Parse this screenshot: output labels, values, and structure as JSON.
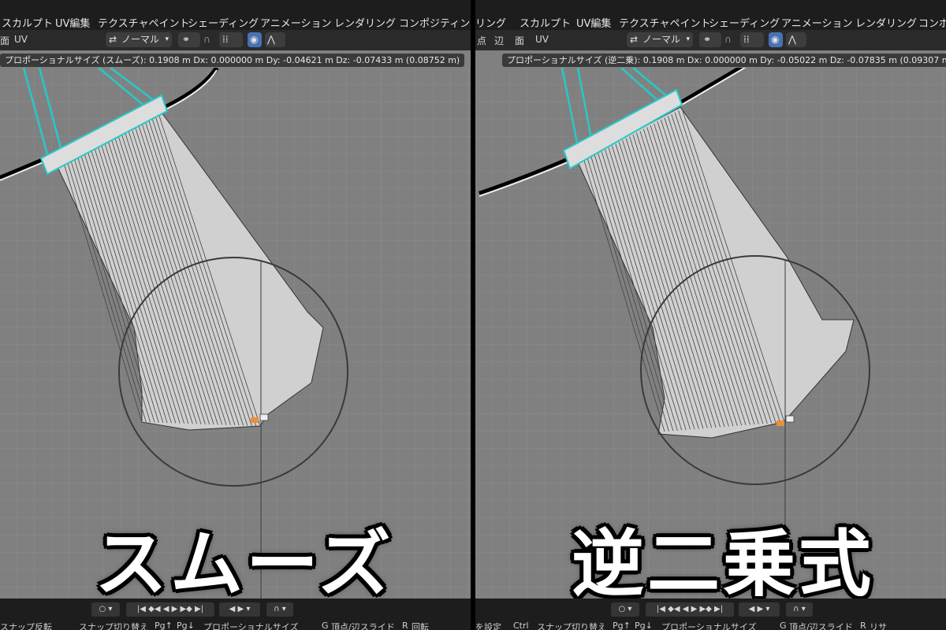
{
  "panels": [
    {
      "menu": [
        "スカルプト",
        "UV編集",
        "テクスチャペイント",
        "シェーディング",
        "アニメーション",
        "レンダリング",
        "コンポジティング"
      ],
      "toolbar": {
        "left": [
          "面",
          "UV"
        ],
        "orientation": "ノーマル"
      },
      "status": "プロポーショナルサイズ (スムーズ): 0.1908 m   Dx: 0.000000 m   Dy: -0.04621 m   Dz: -0.07433 m (0.08752 m)",
      "caption": "スムーズ",
      "hints": [
        "スナップ反転",
        "スナップ切り替え",
        "プロポーショナルサイズ",
        "頂点/辺スライド",
        "回転"
      ]
    },
    {
      "menu": [
        "リング",
        "スカルプト",
        "UV編集",
        "テクスチャペイント",
        "シェーディング",
        "アニメーション",
        "レンダリング",
        "コンポ"
      ],
      "toolbar": {
        "left": [
          "点",
          "辺",
          "面",
          "UV"
        ],
        "orientation": "ノーマル"
      },
      "status": "プロポーショナルサイズ (逆二乗): 0.1908 m   Dx: 0.000000 m   Dy: -0.05022 m   Dz: -0.07835 m (0.09307 m)",
      "caption": "逆二乗式",
      "hints": [
        "を設定",
        "スナップ切り替え",
        "プロポーショナルサイズ",
        "頂点/辺スライド",
        "リサ"
      ]
    }
  ],
  "key_labels": {
    "ctrl": "Ctrl",
    "pgup": "Pg↑",
    "pgdn": "Pg↓",
    "g": "G",
    "r": "R"
  },
  "colors": {
    "viewport_bg": "#808080",
    "header_bg": "#1d1d1d",
    "toolbar_bg": "#2a2a2a",
    "selection_cyan": "#28c8c8",
    "accent_blue": "#4772b3",
    "vertex_orange": "#e8903a"
  },
  "icons": [
    "object-mode-icon",
    "snap-icon",
    "proportional-edit-icon",
    "falloff-curve-icon",
    "playback-controls-icon"
  ]
}
